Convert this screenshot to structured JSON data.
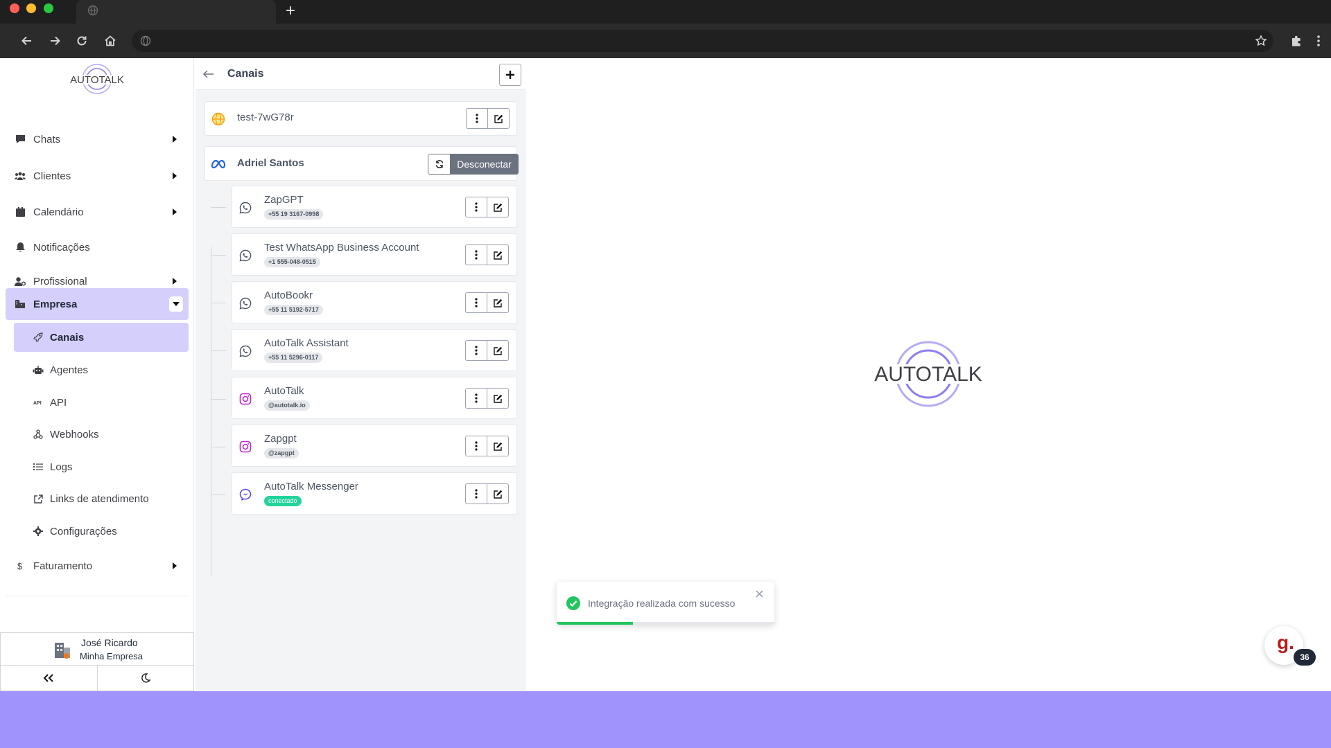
{
  "browser": {
    "traffic_lights": [
      "#ff5f57",
      "#febc2e",
      "#28c840"
    ],
    "tab_icon": "globe-icon",
    "nav_icons": [
      "back-arrow-icon",
      "forward-arrow-icon",
      "reload-icon",
      "home-icon"
    ],
    "toolbar_icons": [
      "bookmark-star-icon",
      "extensions-puzzle-icon",
      "menu-kebab-icon"
    ]
  },
  "sidebar": {
    "logo_text": "AUTOTALK",
    "items": [
      {
        "label": "Chats",
        "icon": "chat-icon"
      },
      {
        "label": "Clientes",
        "icon": "users-icon"
      },
      {
        "label": "Calendário",
        "icon": "calendar-icon"
      },
      {
        "label": "Notificações",
        "icon": "bell-icon"
      },
      {
        "label": "Profissional",
        "icon": "user-gear-icon"
      },
      {
        "label": "Empresa",
        "icon": "building-icon"
      },
      {
        "label": "Faturamento",
        "icon": "dollar-icon"
      }
    ],
    "subitems": [
      {
        "label": "Canais",
        "icon": "rocket-icon"
      },
      {
        "label": "Agentes",
        "icon": "robot-icon"
      },
      {
        "label": "API",
        "icon": "api-icon"
      },
      {
        "label": "Webhooks",
        "icon": "webhook-icon"
      },
      {
        "label": "Logs",
        "icon": "list-icon"
      },
      {
        "label": "Links de atendimento",
        "icon": "external-link-icon"
      },
      {
        "label": "Configurações",
        "icon": "gear-icon"
      }
    ],
    "active_item": "Empresa",
    "active_subitem": "Canais",
    "user": {
      "name": "José Ricardo",
      "company": "Minha Empresa"
    }
  },
  "channels": {
    "title": "Canais",
    "standalone": {
      "name": "test-7wG78r",
      "icon": "globe-icon"
    },
    "meta_account": {
      "name": "Adriel Santos",
      "icon": "meta-icon",
      "disconnect_label": "Desconectar"
    },
    "children": [
      {
        "name": "ZapGPT",
        "badge": "+55 19 3167-0998",
        "icon": "whatsapp-icon"
      },
      {
        "name": "Test WhatsApp Business Account",
        "badge": "+1 555-048-0515",
        "icon": "whatsapp-icon"
      },
      {
        "name": "AutoBookr",
        "badge": "+55 11 5192-5717",
        "icon": "whatsapp-icon"
      },
      {
        "name": "AutoTalk Assistant",
        "badge": "+55 11 5296-0117",
        "icon": "whatsapp-icon"
      },
      {
        "name": "AutoTalk",
        "badge": "@autotalk.io",
        "icon": "instagram-icon"
      },
      {
        "name": "Zapgpt",
        "badge": "@zapgpt",
        "icon": "instagram-icon"
      },
      {
        "name": "AutoTalk Messenger",
        "badge": "conectado",
        "icon": "messenger-icon"
      }
    ]
  },
  "main": {
    "logo_text": "AUTOTALK"
  },
  "toast": {
    "message": "Integração realizada com sucesso",
    "progress": 0.35
  },
  "help_widget": {
    "glyph": "g.",
    "count": "36"
  },
  "colors": {
    "accent": "#d5cffb",
    "brand": "#8b80f0",
    "success": "#22c55e",
    "badge_green": "#22d39b",
    "background": "#a093fa"
  }
}
